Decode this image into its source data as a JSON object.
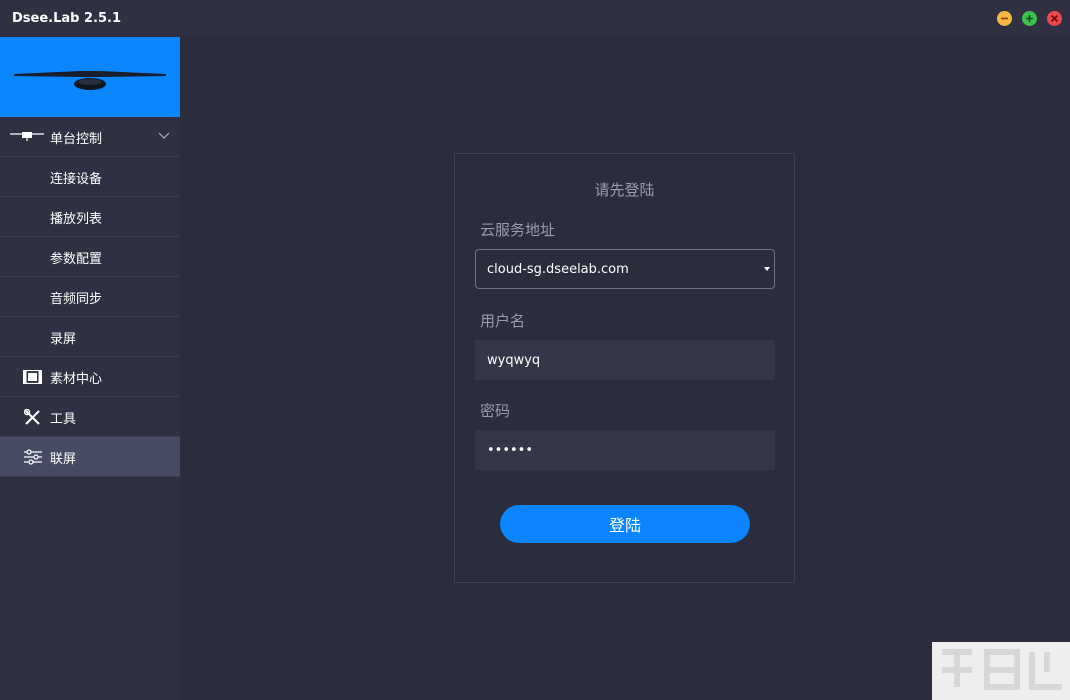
{
  "window": {
    "title": "Dsee.Lab 2.5.1",
    "controls": {
      "minimize_color": "#f5b942",
      "maximize_color": "#3ec14b",
      "close_color": "#f0474a"
    }
  },
  "sidebar": {
    "banner_color": "#0a86ff",
    "items": [
      {
        "label": "单台控制",
        "icon": "screen-icon",
        "expanded": true
      },
      {
        "label": "连接设备"
      },
      {
        "label": "播放列表"
      },
      {
        "label": "参数配置"
      },
      {
        "label": "音频同步"
      },
      {
        "label": "录屏"
      },
      {
        "label": "素材中心",
        "icon": "film-icon"
      },
      {
        "label": "工具",
        "icon": "tools-icon"
      },
      {
        "label": "联屏",
        "icon": "sliders-icon",
        "active": true
      }
    ]
  },
  "login": {
    "title": "请先登陆",
    "server_label": "云服务地址",
    "server_value": "cloud-sg.dseelab.com",
    "username_label": "用户名",
    "username_value": "wyqwyq",
    "password_label": "密码",
    "password_value": "••••••",
    "submit_label": "登陆"
  },
  "colors": {
    "accent": "#0a84ff",
    "background": "#2b2d3c",
    "sidebar": "#2f3142",
    "active_item": "#464a63"
  }
}
